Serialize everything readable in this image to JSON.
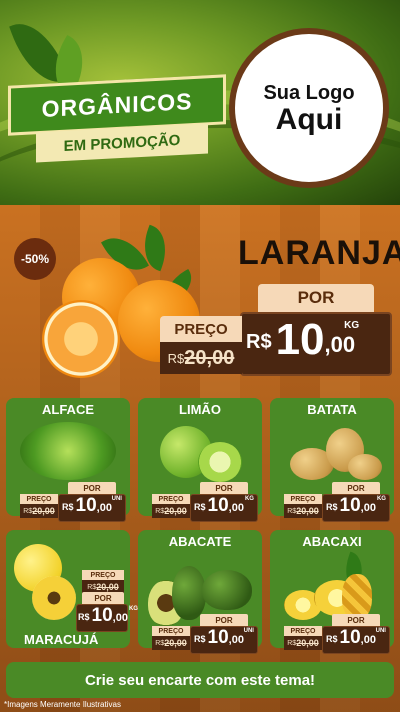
{
  "header": {
    "title": "ORGÂNICOS",
    "subtitle": "EM PROMOÇÃO",
    "logo_line1": "Sua Logo",
    "logo_line2": "Aqui"
  },
  "hero": {
    "discount": "-50%",
    "name": "LARANJA",
    "por_label": "POR",
    "preco_label": "PREÇO",
    "old_currency": "R$",
    "old_price": "20,00",
    "currency": "R$",
    "price_int": "10",
    "price_dec": ",00",
    "unit": "KG"
  },
  "products": [
    {
      "name": "ALFACE",
      "preco_label": "PREÇO",
      "por_label": "POR",
      "old_currency": "R$",
      "old_price": "20,00",
      "currency": "R$",
      "price_int": "10",
      "price_dec": ",00",
      "unit": "UNI"
    },
    {
      "name": "LIMÃO",
      "preco_label": "PREÇO",
      "por_label": "POR",
      "old_currency": "R$",
      "old_price": "20,00",
      "currency": "R$",
      "price_int": "10",
      "price_dec": ",00",
      "unit": "KG"
    },
    {
      "name": "BATATA",
      "preco_label": "PREÇO",
      "por_label": "POR",
      "old_currency": "R$",
      "old_price": "20,00",
      "currency": "R$",
      "price_int": "10",
      "price_dec": ",00",
      "unit": "KG"
    },
    {
      "name": "MARACUJÁ",
      "preco_label": "PREÇO",
      "por_label": "POR",
      "old_currency": "R$",
      "old_price": "20,00",
      "currency": "R$",
      "price_int": "10",
      "price_dec": ",00",
      "unit": "KG"
    },
    {
      "name": "ABACATE",
      "preco_label": "PREÇO",
      "por_label": "POR",
      "old_currency": "R$",
      "old_price": "20,00",
      "currency": "R$",
      "price_int": "10",
      "price_dec": ",00",
      "unit": "UNI"
    },
    {
      "name": "ABACAXI",
      "preco_label": "PREÇO",
      "por_label": "POR",
      "old_currency": "R$",
      "old_price": "20,00",
      "currency": "R$",
      "price_int": "10",
      "price_dec": ",00",
      "unit": "UNI"
    }
  ],
  "footer": {
    "cta": "Crie seu encarte com este tema!",
    "disclaimer": "*Imagens Meramente Ilustrativas"
  },
  "colors": {
    "card_green": "#4a8a26",
    "price_brown": "#4a2611",
    "tag_cream": "#f6d9b8"
  }
}
